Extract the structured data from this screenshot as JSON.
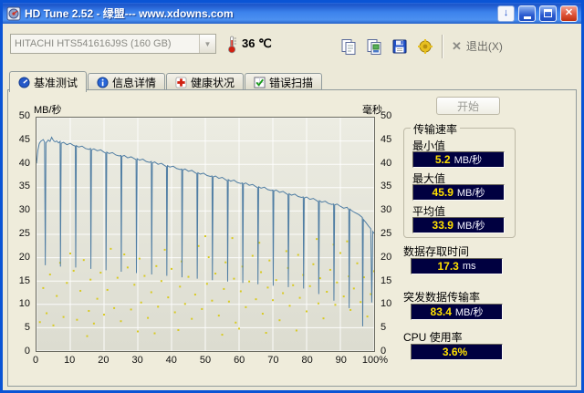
{
  "window": {
    "title": "HD Tune 2.52 - 绿盟--- www.xdowns.com"
  },
  "icons": {
    "download": "↓",
    "close": "✕",
    "exit_x": "✕",
    "combo_arrow": "▼"
  },
  "toolbar": {
    "drive": "HITACHI HTS541616J9S (160 GB)",
    "temperature": "36 ℃",
    "exit_label": "退出(X)"
  },
  "tabs": [
    {
      "label": "基准测试"
    },
    {
      "label": "信息详情"
    },
    {
      "label": "健康状况"
    },
    {
      "label": "错误扫描"
    }
  ],
  "panel": {
    "start_label": "开始"
  },
  "results": {
    "transfer_group_title": "传输速率",
    "min_label": "最小值",
    "min_value": "5.2",
    "min_unit": "MB/秒",
    "max_label": "最大值",
    "max_value": "45.9",
    "max_unit": "MB/秒",
    "avg_label": "平均值",
    "avg_value": "33.9",
    "avg_unit": "MB/秒",
    "access_label": "数据存取时间",
    "access_value": "17.3",
    "access_unit": "ms",
    "burst_label": "突发数据传输率",
    "burst_value": "83.4",
    "burst_unit": "MB/秒",
    "cpu_label": "CPU 使用率",
    "cpu_value": "3.6%",
    "cpu_unit": ""
  },
  "colors": {
    "lcd_bg": "#000040",
    "lcd_num": "#ffe000",
    "line": "#4f7da3",
    "dots": "#d8ca20"
  },
  "chart_data": {
    "type": "line",
    "left_axis_label": "MB/秒",
    "right_axis_label": "毫秒",
    "xlim": [
      0,
      100
    ],
    "ylim": [
      0,
      50
    ],
    "grid": true,
    "x_ticks": [
      "0",
      "10",
      "20",
      "30",
      "40",
      "50",
      "60",
      "70",
      "80",
      "90",
      "100%"
    ],
    "y_ticks": [
      50,
      45,
      40,
      35,
      30,
      25,
      20,
      15,
      10,
      5,
      0
    ],
    "series": [
      {
        "name": "传输速率",
        "type": "line",
        "color": "#4f7da3",
        "points": [
          [
            0,
            40.2
          ],
          [
            0.4,
            43.0
          ],
          [
            0.8,
            44.4
          ],
          [
            1.2,
            44.9
          ],
          [
            1.6,
            45.1
          ],
          [
            2,
            45.3
          ],
          [
            2.4,
            44.8
          ],
          [
            2.6,
            18.4
          ],
          [
            2.8,
            44.6
          ],
          [
            3.5,
            45.2
          ],
          [
            4,
            44.9
          ],
          [
            4.5,
            45.8
          ],
          [
            5,
            45.1
          ],
          [
            5.5,
            44.8
          ],
          [
            6,
            45.0
          ],
          [
            6.5,
            44.6
          ],
          [
            7,
            44.9
          ],
          [
            7.1,
            18.1
          ],
          [
            7.3,
            44.5
          ],
          [
            8,
            44.7
          ],
          [
            9,
            44.2
          ],
          [
            10,
            44.5
          ],
          [
            10.8,
            44.1
          ],
          [
            11.5,
            43.9
          ],
          [
            11.6,
            17.9
          ],
          [
            11.8,
            44.0
          ],
          [
            12.5,
            43.7
          ],
          [
            13.5,
            43.9
          ],
          [
            14.5,
            43.4
          ],
          [
            15.5,
            43.2
          ],
          [
            16,
            43.4
          ],
          [
            16.1,
            17.6
          ],
          [
            16.3,
            43.1
          ],
          [
            17,
            43.3
          ],
          [
            18,
            42.9
          ],
          [
            19,
            43.1
          ],
          [
            20,
            42.6
          ],
          [
            20.5,
            42.4
          ],
          [
            20.6,
            17.3
          ],
          [
            20.8,
            42.6
          ],
          [
            21.5,
            42.3
          ],
          [
            22.5,
            42.5
          ],
          [
            23.5,
            42.0
          ],
          [
            24.5,
            41.8
          ],
          [
            25,
            41.9
          ],
          [
            25.1,
            17.0
          ],
          [
            25.3,
            41.7
          ],
          [
            26,
            41.9
          ],
          [
            27,
            41.4
          ],
          [
            28,
            41.6
          ],
          [
            29,
            41.2
          ],
          [
            29.5,
            41.0
          ],
          [
            29.6,
            16.7
          ],
          [
            29.8,
            41.2
          ],
          [
            30.5,
            40.9
          ],
          [
            31.5,
            41.1
          ],
          [
            32.5,
            40.6
          ],
          [
            33.5,
            40.4
          ],
          [
            34,
            40.6
          ],
          [
            34.1,
            16.4
          ],
          [
            34.3,
            40.3
          ],
          [
            35,
            40.5
          ],
          [
            36,
            40.0
          ],
          [
            37,
            40.2
          ],
          [
            38,
            39.7
          ],
          [
            38.5,
            39.5
          ],
          [
            38.6,
            16.1
          ],
          [
            38.8,
            39.7
          ],
          [
            39.5,
            39.4
          ],
          [
            40.5,
            39.6
          ],
          [
            41.5,
            39.1
          ],
          [
            42.5,
            38.9
          ],
          [
            43,
            39.0
          ],
          [
            43.1,
            15.8
          ],
          [
            43.3,
            38.8
          ],
          [
            44,
            39.0
          ],
          [
            45,
            38.5
          ],
          [
            46,
            38.7
          ],
          [
            47,
            38.2
          ],
          [
            47.5,
            38.0
          ],
          [
            47.6,
            15.5
          ],
          [
            47.8,
            38.2
          ],
          [
            48.5,
            37.9
          ],
          [
            49.5,
            38.1
          ],
          [
            50.5,
            37.6
          ],
          [
            51.5,
            37.4
          ],
          [
            52,
            37.5
          ],
          [
            52.1,
            15.2
          ],
          [
            52.3,
            37.3
          ],
          [
            53,
            37.5
          ],
          [
            54,
            37.0
          ],
          [
            55,
            37.2
          ],
          [
            56,
            36.7
          ],
          [
            56.5,
            36.5
          ],
          [
            56.6,
            14.9
          ],
          [
            56.8,
            36.7
          ],
          [
            57.5,
            36.4
          ],
          [
            58.5,
            36.6
          ],
          [
            59.5,
            36.1
          ],
          [
            60.5,
            35.9
          ],
          [
            61,
            36.0
          ],
          [
            61.1,
            14.6
          ],
          [
            61.3,
            35.8
          ],
          [
            62,
            36.0
          ],
          [
            63,
            35.5
          ],
          [
            64,
            35.7
          ],
          [
            65,
            35.2
          ],
          [
            65.5,
            35.0
          ],
          [
            65.6,
            14.3
          ],
          [
            65.8,
            35.2
          ],
          [
            66.5,
            34.9
          ],
          [
            67.5,
            35.1
          ],
          [
            68.5,
            34.6
          ],
          [
            69.5,
            34.4
          ],
          [
            70,
            34.5
          ],
          [
            70.1,
            14.0
          ],
          [
            70.3,
            34.3
          ],
          [
            71,
            34.5
          ],
          [
            72,
            34.0
          ],
          [
            73,
            34.2
          ],
          [
            74,
            33.7
          ],
          [
            74.5,
            33.5
          ],
          [
            74.6,
            13.7
          ],
          [
            74.8,
            33.7
          ],
          [
            75.5,
            33.4
          ],
          [
            76.5,
            33.6
          ],
          [
            77.5,
            33.1
          ],
          [
            78.5,
            32.9
          ],
          [
            79,
            33.0
          ],
          [
            79.1,
            13.4
          ],
          [
            79.3,
            32.8
          ],
          [
            80,
            33.0
          ],
          [
            81,
            32.5
          ],
          [
            82,
            32.7
          ],
          [
            83,
            32.2
          ],
          [
            83.5,
            32.0
          ],
          [
            83.6,
            12.2
          ],
          [
            83.8,
            32.2
          ],
          [
            84.5,
            31.9
          ],
          [
            85.5,
            32.1
          ],
          [
            86.5,
            31.6
          ],
          [
            87.5,
            31.4
          ],
          [
            88,
            31.5
          ],
          [
            88.1,
            10.8
          ],
          [
            88.3,
            31.3
          ],
          [
            89,
            31.5
          ],
          [
            90,
            31.0
          ],
          [
            91,
            30.6
          ],
          [
            92,
            30.8
          ],
          [
            92.5,
            30.3
          ],
          [
            92.6,
            9.2
          ],
          [
            92.8,
            30.4
          ],
          [
            93.5,
            30.0
          ],
          [
            94.5,
            29.6
          ],
          [
            95.5,
            29.2
          ],
          [
            96.5,
            28.6
          ],
          [
            96.6,
            5.3
          ],
          [
            96.8,
            28.2
          ],
          [
            97.5,
            27.6
          ],
          [
            98.3,
            26.8
          ],
          [
            99,
            26.2
          ],
          [
            99.3,
            10.4
          ],
          [
            99.6,
            25.6
          ],
          [
            100,
            25.2
          ]
        ]
      },
      {
        "name": "存取时间",
        "type": "scatter",
        "color": "#d8ca20",
        "points": [
          [
            1,
            6.2
          ],
          [
            2,
            13.5
          ],
          [
            3,
            8.1
          ],
          [
            4,
            16.4
          ],
          [
            5,
            5.5
          ],
          [
            6,
            11.8
          ],
          [
            7,
            18.9
          ],
          [
            8,
            7.3
          ],
          [
            9,
            14.6
          ],
          [
            10,
            20.9
          ],
          [
            11,
            17.2
          ],
          [
            12,
            6.7
          ],
          [
            13,
            12.9
          ],
          [
            14,
            19.5
          ],
          [
            15,
            3.2
          ],
          [
            15.5,
            8.6
          ],
          [
            16,
            15.3
          ],
          [
            17,
            5.9
          ],
          [
            18,
            11.2
          ],
          [
            19,
            16.8
          ],
          [
            20,
            7.8
          ],
          [
            21,
            13.1
          ],
          [
            22,
            21.9
          ],
          [
            23,
            9.2
          ],
          [
            24,
            15.7
          ],
          [
            25,
            6.4
          ],
          [
            26,
            20.7
          ],
          [
            27,
            17.9
          ],
          [
            28,
            8.9
          ],
          [
            29,
            14.2
          ],
          [
            30,
            4.2
          ],
          [
            30.5,
            19.8
          ],
          [
            31,
            10.4
          ],
          [
            32,
            16.1
          ],
          [
            33,
            7.1
          ],
          [
            34,
            12.6
          ],
          [
            35,
            3.8
          ],
          [
            35.5,
            18.2
          ],
          [
            36,
            9.5
          ],
          [
            37,
            15.0
          ],
          [
            38,
            21.7
          ],
          [
            39,
            11.5
          ],
          [
            40,
            17.6
          ],
          [
            41,
            8.3
          ],
          [
            42,
            4.5
          ],
          [
            42.5,
            13.8
          ],
          [
            43,
            19.2
          ],
          [
            44,
            10.1
          ],
          [
            45,
            15.9
          ],
          [
            46,
            6.9
          ],
          [
            47,
            12.1
          ],
          [
            48,
            22.5
          ],
          [
            49,
            9.0
          ],
          [
            50,
            24.6
          ],
          [
            50.5,
            14.4
          ],
          [
            51,
            20.1
          ],
          [
            52,
            10.8
          ],
          [
            53,
            16.6
          ],
          [
            54,
            7.6
          ],
          [
            55,
            3.5
          ],
          [
            55.5,
            13.3
          ],
          [
            56,
            19.0
          ],
          [
            57,
            10.6
          ],
          [
            58,
            24.2
          ],
          [
            58.5,
            15.5
          ],
          [
            59,
            6.1
          ],
          [
            60,
            4.8
          ],
          [
            60.5,
            12.8
          ],
          [
            61,
            18.1
          ],
          [
            62,
            9.4
          ],
          [
            63,
            14.9
          ],
          [
            64,
            20.4
          ],
          [
            65,
            11.1
          ],
          [
            66,
            23.2
          ],
          [
            66.5,
            16.9
          ],
          [
            67,
            8.0
          ],
          [
            68,
            3.9
          ],
          [
            68.5,
            13.6
          ],
          [
            69,
            19.4
          ],
          [
            70,
            10.9
          ],
          [
            71,
            15.2
          ],
          [
            72,
            6.6
          ],
          [
            73,
            12.4
          ],
          [
            74,
            21.4
          ],
          [
            74.5,
            17.8
          ],
          [
            75,
            9.7
          ],
          [
            76,
            14.1
          ],
          [
            77,
            4.4
          ],
          [
            77.5,
            20.6
          ],
          [
            78,
            11.4
          ],
          [
            79,
            16.3
          ],
          [
            80,
            8.5
          ],
          [
            81,
            13.9
          ],
          [
            82,
            18.6
          ],
          [
            83,
            24.0
          ],
          [
            83.5,
            10.2
          ],
          [
            84,
            15.6
          ],
          [
            85,
            7.0
          ],
          [
            86,
            12.7
          ],
          [
            87,
            17.4
          ],
          [
            88,
            22.8
          ],
          [
            88.5,
            9.9
          ],
          [
            89,
            14.7
          ],
          [
            90,
            21.0
          ],
          [
            91,
            11.7
          ],
          [
            92,
            23.5
          ],
          [
            92.5,
            16.0
          ],
          [
            93,
            8.8
          ],
          [
            94,
            13.4
          ],
          [
            95,
            18.8
          ],
          [
            96,
            10.5
          ],
          [
            97,
            15.8
          ],
          [
            98,
            7.4
          ],
          [
            99,
            12.2
          ],
          [
            100,
            17.1
          ]
        ]
      }
    ]
  }
}
